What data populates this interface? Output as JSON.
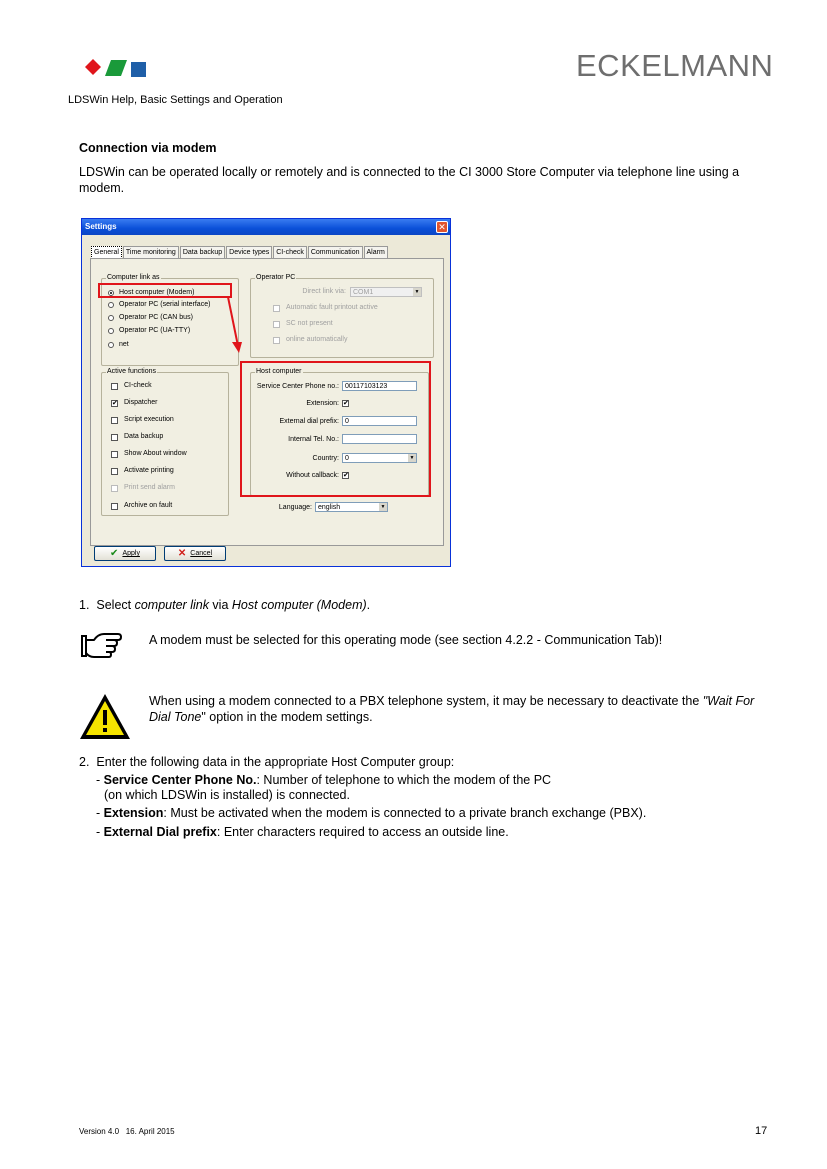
{
  "header": {
    "brand": "ECKELMANN",
    "doc_title": "LDSWin Help, Basic Settings and Operation",
    "logo_colors": [
      "#e0151b",
      "#1a9a3a",
      "#1f5fa8"
    ]
  },
  "section": {
    "title": "Connection via modem",
    "intro": "LDSWin can be operated locally or remotely and is connected to the CI 3000 Store Computer via telephone line using a modem."
  },
  "dialog": {
    "title": "Settings",
    "close_glyph": "✕",
    "tabs": [
      "General",
      "Time monitoring",
      "Data backup",
      "Device types",
      "CI-check",
      "Communication",
      "Alarm"
    ],
    "computer_link": {
      "label": "Computer link as",
      "options": [
        {
          "label": "Host computer (Modem)",
          "selected": true
        },
        {
          "label": "Operator PC (serial interface)",
          "selected": false
        },
        {
          "label": "Operator PC (CAN bus)",
          "selected": false
        },
        {
          "label": "Operator PC (UA-TTY)",
          "selected": false
        },
        {
          "label": "net",
          "selected": false
        }
      ]
    },
    "operator_pc": {
      "label": "Operator PC",
      "direct_link_label": "Direct link via:",
      "direct_link_value": "COM1",
      "checks": [
        {
          "label": "Automatic fault printout active",
          "checked": false
        },
        {
          "label": "SC not present",
          "checked": false
        },
        {
          "label": "online automatically",
          "checked": false
        }
      ]
    },
    "active_functions": {
      "label": "Active functions",
      "items": [
        {
          "label": "CI-check",
          "checked": false,
          "disabled": false
        },
        {
          "label": "Dispatcher",
          "checked": true,
          "disabled": false
        },
        {
          "label": "Script execution",
          "checked": false,
          "disabled": false
        },
        {
          "label": "Data backup",
          "checked": false,
          "disabled": false
        },
        {
          "label": "Show About window",
          "checked": false,
          "disabled": false
        },
        {
          "label": "Activate printing",
          "checked": false,
          "disabled": false
        },
        {
          "label": "Print send alarm",
          "checked": false,
          "disabled": true
        },
        {
          "label": "Archive on fault",
          "checked": false,
          "disabled": false
        }
      ]
    },
    "host_computer": {
      "label": "Host computer",
      "service_center_label": "Service Center Phone no.:",
      "service_center_value": "00117103123",
      "extension_label": "Extension:",
      "extension_checked": true,
      "external_dial_label": "External dial prefix:",
      "external_dial_value": "0",
      "internal_tel_label": "Internal Tel. No.:",
      "internal_tel_value": "",
      "country_label": "Country:",
      "country_value": "0",
      "without_callback_label": "Without callback:",
      "without_callback_checked": true
    },
    "language_label": "Language:",
    "language_value": "english",
    "apply_label": "Apply",
    "cancel_label": "Cancel",
    "check_glyph": "✔",
    "dd_glyph": "▼"
  },
  "steps": {
    "step1_num": "1.",
    "step1_pre": "Select ",
    "step1_em1": "computer link",
    "step1_mid": " via ",
    "step1_em2": "Host computer (Modem)",
    "step1_post": ".",
    "note": "A modem must be selected for this operating mode (see section 4.2.2 - Communication Tab)!",
    "warn_pre": "When using a modem connected to a PBX telephone system, it may be necessary to deactivate the ",
    "warn_em": "\"Wait For Dial Tone",
    "warn_post": "\" option in the modem settings.",
    "step2_num": "2.",
    "step2": "Enter the following data in the appropriate Host Computer group:",
    "bullets": [
      {
        "dash": "- ",
        "term": "Service Center Phone No.",
        "text": ": Number of telephone to which the modem of the PC",
        "cont": "(on which LDSWin is installed) is connected."
      },
      {
        "dash": "- ",
        "term": "Extension",
        "text": ": Must be activated when the modem is connected to a private branch exchange (PBX).",
        "cont": ""
      },
      {
        "dash": "- ",
        "term": "External Dial prefix",
        "text": ": Enter characters required to access an outside line.",
        "cont": ""
      }
    ]
  },
  "footer": {
    "version": "Version 4.0   16. April 2015",
    "page": "17"
  }
}
